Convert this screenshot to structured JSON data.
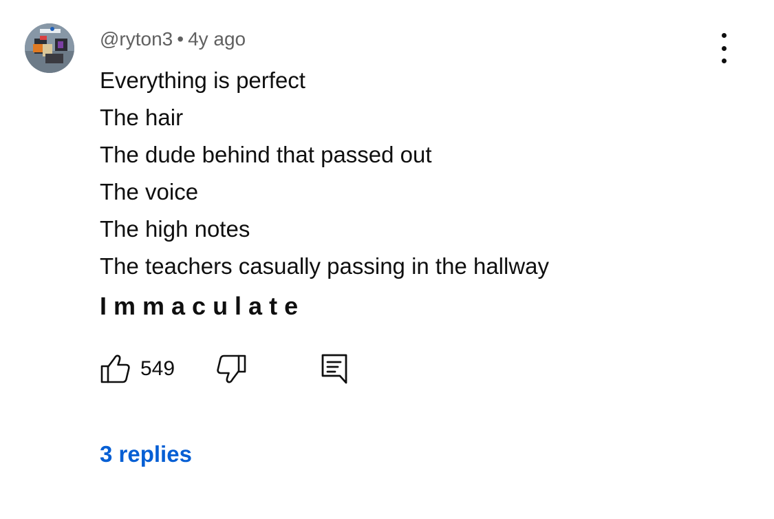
{
  "comment": {
    "author": "@ryton3",
    "separator": "•",
    "time": "4y ago",
    "lines": [
      "Everything is perfect",
      "The hair",
      "The dude behind that passed out",
      "The voice",
      "The high notes",
      "The teachers casually passing in the hallway"
    ],
    "emphasis_line": "Immaculate"
  },
  "actions": {
    "like_icon": "thumbs-up-icon",
    "like_count": "549",
    "dislike_icon": "thumbs-down-icon",
    "reply_icon": "comment-reply-icon"
  },
  "menu": {
    "icon": "more-vertical-icon"
  },
  "replies": {
    "label": "3 replies",
    "color": "#065fd4"
  }
}
